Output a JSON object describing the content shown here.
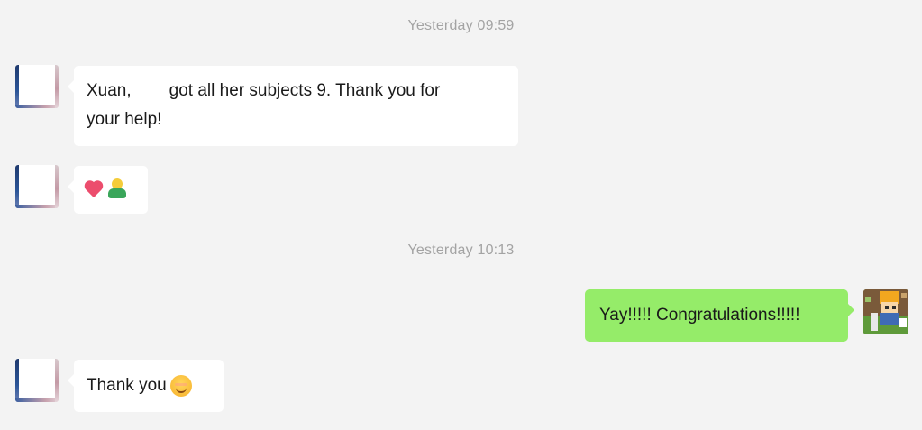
{
  "chat": {
    "timestamps": [
      "Yesterday 09:59",
      "Yesterday 10:13"
    ],
    "messages": [
      {
        "sender": "other",
        "text_before_gap": "Xuan,",
        "text_after_gap": "got all her subjects 9. Thank you for",
        "text_line2": "your help!"
      },
      {
        "sender": "other",
        "emojis": [
          "heart-emoji",
          "hug-emoji"
        ]
      },
      {
        "sender": "self",
        "text": "Yay!!!!! Congratulations!!!!!"
      },
      {
        "sender": "other",
        "text": "Thank you",
        "emoji": "smile-emoji"
      }
    ]
  },
  "colors": {
    "background": "#f3f3f3",
    "incoming_bubble": "#ffffff",
    "outgoing_bubble": "#95ec69",
    "timestamp": "#a3a3a3"
  }
}
